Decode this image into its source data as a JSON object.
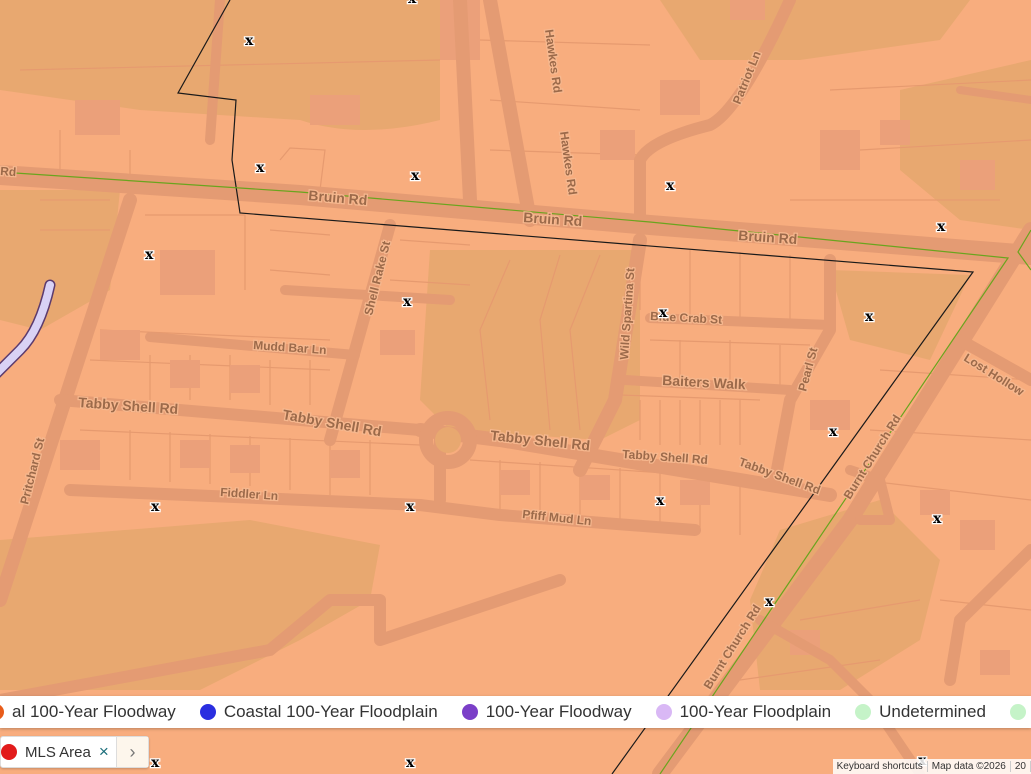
{
  "map": {
    "street_labels": [
      "Bruin Rd",
      "Bruin Rd",
      "Bruin Rd",
      "Hawkes Rd",
      "Hawkes Rd",
      "Patriot Ln",
      "Shell Rake St",
      "Mudd Bar Ln",
      "Wild Spartina St",
      "Blue Crab St",
      "Baiters Walk",
      "Pearl St",
      "Tabby Shell Rd",
      "Tabby Shell Rd",
      "Tabby Shell Rd",
      "Tabby Shell Rd",
      "Tabby Shell Rd",
      "Pritchard St",
      "Fiddler Ln",
      "Pfiff Mud Ln",
      "Burnt Church Rd",
      "Burnt Church Rd",
      "Lost Hollow",
      "Rd"
    ],
    "marker_symbol": "x",
    "colors": {
      "zone_orange": "#f8ad7e",
      "zone_khaki": "#e8a870",
      "road": "#e49b73",
      "boundary_mls": "#000000",
      "boundary_green": "#6aa41e"
    }
  },
  "legend": [
    {
      "label": "al 100-Year Floodway",
      "color": "#e85c1a"
    },
    {
      "label": "Coastal 100-Year Floodplain",
      "color": "#2a2ee0"
    },
    {
      "label": "100-Year Floodway",
      "color": "#7b3fc8"
    },
    {
      "label": "100-Year Floodplain",
      "color": "#d9b8f5"
    },
    {
      "label": "Undetermined",
      "color": "#c5f3c8"
    },
    {
      "label": "",
      "color": "#c5f3c8"
    }
  ],
  "mls_filter": {
    "label": "MLS Area",
    "dot_color": "#e21b1b",
    "close_icon": "×",
    "expand_icon": "›"
  },
  "attribution": {
    "shortcuts": "Keyboard shortcuts",
    "data": "Map data ©2026",
    "extra": "20"
  }
}
